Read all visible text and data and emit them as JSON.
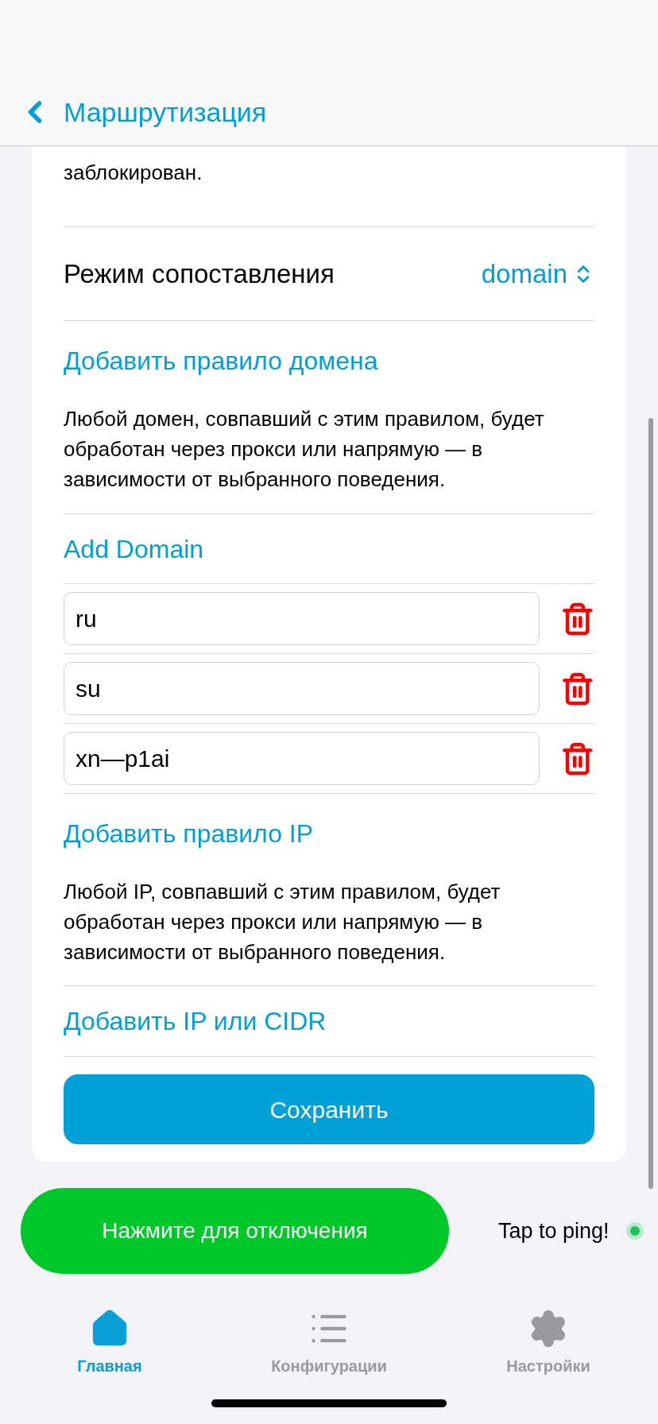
{
  "nav": {
    "back_title": "Маршрутизация"
  },
  "intro_tail": "заблокирован.",
  "match_mode": {
    "label": "Режим сопоставления",
    "value": "domain"
  },
  "domain_rule": {
    "title": "Добавить правило домена",
    "description": "Любой домен, совпавший с этим правилом, будет обработан через прокси или напрямую — в зависимости от выбранного поведения.",
    "add_label": "Add Domain"
  },
  "domains": [
    {
      "value": "ru"
    },
    {
      "value": "su"
    },
    {
      "value": "xn—p1ai"
    }
  ],
  "ip_rule": {
    "title": "Добавить правило IP",
    "description": "Любой IP, совпавший с этим правилом, будет обработан через прокси или напрямую — в зависимости от выбранного поведения.",
    "add_label": "Добавить IP или CIDR"
  },
  "save_button": "Сохранить",
  "connect_button": "Нажмите для отключения",
  "ping": {
    "label": "Tap to ping!",
    "color": "#1fc35a"
  },
  "tabs": [
    {
      "label": "Главная",
      "kind": "home",
      "selected": true
    },
    {
      "label": "Конфигурации",
      "kind": "list",
      "selected": false
    },
    {
      "label": "Настройки",
      "kind": "settings",
      "selected": false
    }
  ]
}
